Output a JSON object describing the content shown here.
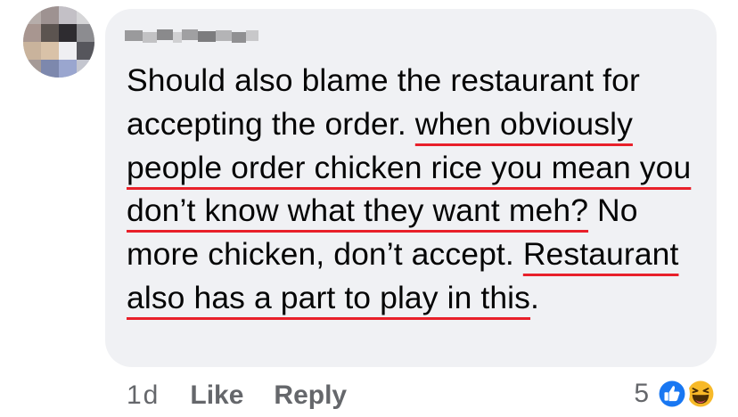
{
  "comment": {
    "author_obscured": true,
    "segments": [
      {
        "text": "Should also blame the restaurant for accepting the order. ",
        "underline": false
      },
      {
        "text": "when obviously people order chicken rice you mean you don’t know what they want meh?",
        "underline": true
      },
      {
        "text": " No more chicken, don’t accept. ",
        "underline": false
      },
      {
        "text": "Restaurant also has a part to play in this",
        "underline": true
      },
      {
        "text": ".",
        "underline": false
      }
    ],
    "underline_color": "#e8202a"
  },
  "actions": {
    "time": "1d",
    "like_label": "Like",
    "reply_label": "Reply"
  },
  "reactions": {
    "count": "5",
    "icons": [
      "like-icon",
      "haha-icon"
    ]
  },
  "colors": {
    "bubble": "#f0f1f4",
    "meta_text": "#65676b",
    "like_blue": "#1877f2",
    "haha_yellow": "#f7b928"
  }
}
